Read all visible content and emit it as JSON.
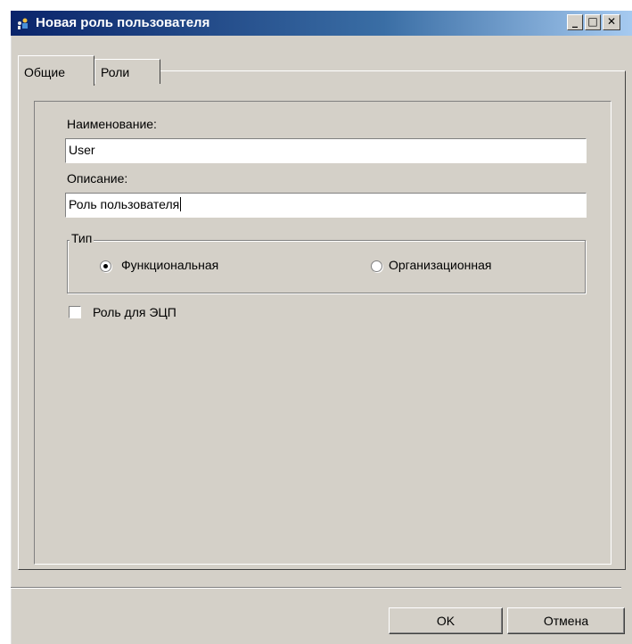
{
  "window": {
    "title": "Новая роль пользователя",
    "icon": "user-role-icon",
    "controls": {
      "minimize": "_",
      "maximize": "□",
      "close": "✕"
    }
  },
  "tabs": [
    {
      "label": "Общие",
      "selected": true
    },
    {
      "label": "Роли",
      "selected": false
    }
  ],
  "form": {
    "name_label": "Наименование:",
    "name_value": "User",
    "description_label": "Описание:",
    "description_value": "Роль пользователя",
    "type_group": {
      "label": "Тип",
      "options": [
        {
          "label": "Функциональная",
          "selected": true
        },
        {
          "label": "Организационная",
          "selected": false
        }
      ]
    },
    "digital_signature_role": {
      "label": "Роль для ЭЦП",
      "checked": false
    }
  },
  "buttons": {
    "ok": "OK",
    "cancel": "Отмена"
  }
}
